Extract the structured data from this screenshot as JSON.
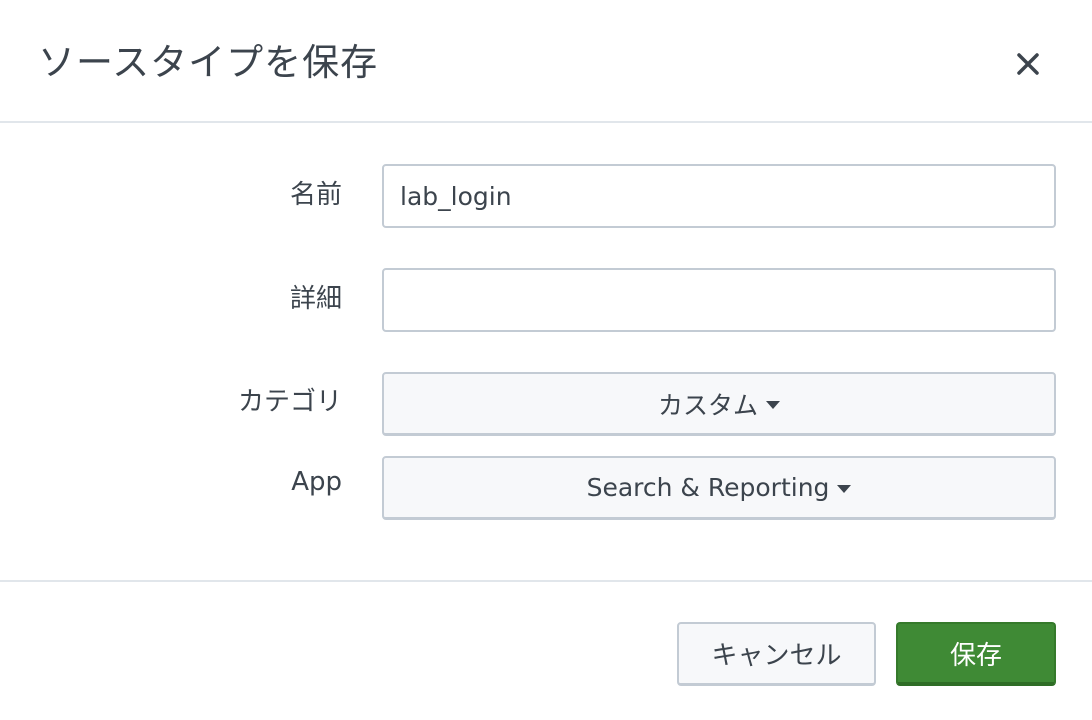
{
  "dialog": {
    "title": "ソースタイプを保存",
    "close_icon": "close-icon"
  },
  "form": {
    "name": {
      "label": "名前",
      "value": "lab_login",
      "placeholder": ""
    },
    "description": {
      "label": "詳細",
      "value": "",
      "placeholder": ""
    },
    "category": {
      "label": "カテゴリ",
      "selected": "カスタム"
    },
    "app": {
      "label": "App",
      "selected": "Search & Reporting"
    }
  },
  "footer": {
    "cancel_label": "キャンセル",
    "save_label": "保存"
  },
  "colors": {
    "primary": "#3f8a35",
    "border": "#c3cbd4",
    "text": "#3c444d",
    "divider": "#e1e6eb"
  }
}
